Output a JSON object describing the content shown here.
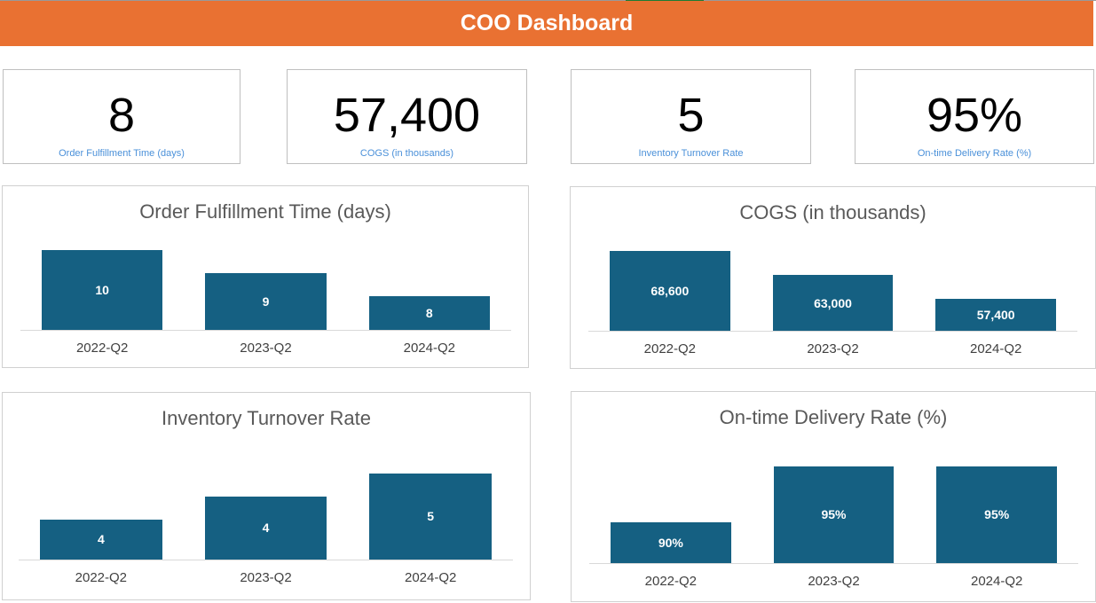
{
  "header": {
    "title": "COO Dashboard"
  },
  "kpis": [
    {
      "value": "8",
      "label": "Order Fulfillment Time (days)"
    },
    {
      "value": "57,400",
      "label": "COGS (in thousands)"
    },
    {
      "value": "5",
      "label": "Inventory Turnover Rate"
    },
    {
      "value": "95%",
      "label": "On-time Delivery Rate (%)"
    }
  ],
  "chart_data": [
    {
      "type": "bar",
      "title": "Order Fulfillment Time (days)",
      "categories": [
        "2022-Q2",
        "2023-Q2",
        "2024-Q2"
      ],
      "values": [
        10,
        9,
        8
      ],
      "labels": [
        "10",
        "9",
        "8"
      ],
      "ylim": [
        6.5,
        10.4
      ],
      "color": "#156082"
    },
    {
      "type": "bar",
      "title": "COGS (in thousands)",
      "categories": [
        "2022-Q2",
        "2023-Q2",
        "2024-Q2"
      ],
      "values": [
        68600,
        63000,
        57400
      ],
      "labels": [
        "68,600",
        "63,000",
        "57,400"
      ],
      "ylim": [
        50000,
        70740
      ],
      "color": "#156082"
    },
    {
      "type": "bar",
      "title": "Inventory Turnover Rate",
      "categories": [
        "2022-Q2",
        "2023-Q2",
        "2024-Q2"
      ],
      "values": [
        4.0,
        4.4,
        4.8
      ],
      "labels": [
        "4",
        "4",
        "5"
      ],
      "ylim": [
        3.3,
        4.84
      ],
      "color": "#156082"
    },
    {
      "type": "bar",
      "title": "On-time Delivery Rate (%)",
      "categories": [
        "2022-Q2",
        "2023-Q2",
        "2024-Q2"
      ],
      "values": [
        90,
        95,
        95
      ],
      "labels": [
        "90%",
        "95%",
        "95%"
      ],
      "ylim": [
        86.3,
        95.3
      ],
      "color": "#156082"
    }
  ]
}
